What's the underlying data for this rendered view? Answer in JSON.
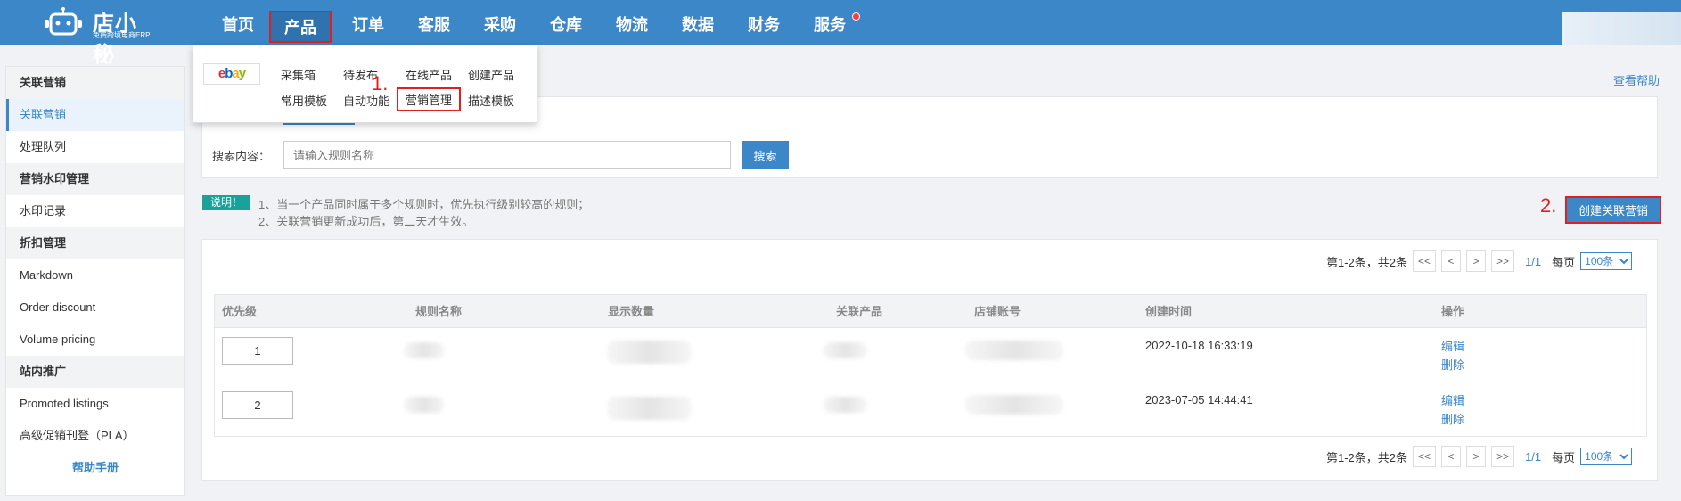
{
  "brand": {
    "title": "店小秘",
    "subtitle": "免费跨境电商ERP"
  },
  "nav": [
    {
      "label": "首页"
    },
    {
      "label": "产品"
    },
    {
      "label": "订单"
    },
    {
      "label": "客服"
    },
    {
      "label": "采购"
    },
    {
      "label": "仓库"
    },
    {
      "label": "物流"
    },
    {
      "label": "数据"
    },
    {
      "label": "财务"
    },
    {
      "label": "服务"
    }
  ],
  "product_menu": {
    "platform_logo": [
      "e",
      "b",
      "a",
      "y"
    ],
    "items": [
      "采集箱",
      "待发布",
      "在线产品",
      "创建产品",
      "常用模板",
      "自动功能",
      "营销管理",
      "描述模板"
    ]
  },
  "sidebar": {
    "groups": [
      {
        "title": "关联营销",
        "items": [
          "关联营销",
          "处理队列"
        ]
      },
      {
        "title": "营销水印管理",
        "items": [
          "水印记录"
        ]
      },
      {
        "title": "折扣管理",
        "items": [
          "Markdown",
          "Order discount",
          "Volume pricing"
        ]
      },
      {
        "title": "站内推广",
        "items": [
          "Promoted listings",
          "高级促销刊登（PLA）"
        ]
      }
    ],
    "help": "帮助手册"
  },
  "header": {
    "help_link": "查看帮助"
  },
  "search": {
    "label": "搜索内容：",
    "placeholder": "请输入规则名称",
    "button": "搜索"
  },
  "note": {
    "badge": "说明！",
    "lines": [
      "1、当一个产品同时属于多个规则时，优先执行级别较高的规则；",
      "2、关联营销更新成功后，第二天才生效。"
    ]
  },
  "annotations": {
    "step1": "1.",
    "step2": "2."
  },
  "create_button": "创建关联营销",
  "pager": {
    "summary": "第1-2条，共2条",
    "first": "<<",
    "prev": "<",
    "next": ">",
    "last": ">>",
    "page": "1/1",
    "per_page_label": "每页",
    "per_page_value": "100条"
  },
  "table": {
    "columns": [
      "优先级",
      "规则名称",
      "显示数量",
      "关联产品",
      "店铺账号",
      "创建时间",
      "操作"
    ],
    "rows": [
      {
        "priority": "1",
        "created": "2022-10-18 16:33:19",
        "edit": "编辑",
        "delete": "删除"
      },
      {
        "priority": "2",
        "created": "2023-07-05 14:44:41",
        "edit": "编辑",
        "delete": "删除"
      }
    ]
  },
  "colors": {
    "nav_bg": "#3b87c8",
    "accent": "#3b87c8",
    "highlight": "#e02020",
    "badge": "#1aa29a"
  }
}
